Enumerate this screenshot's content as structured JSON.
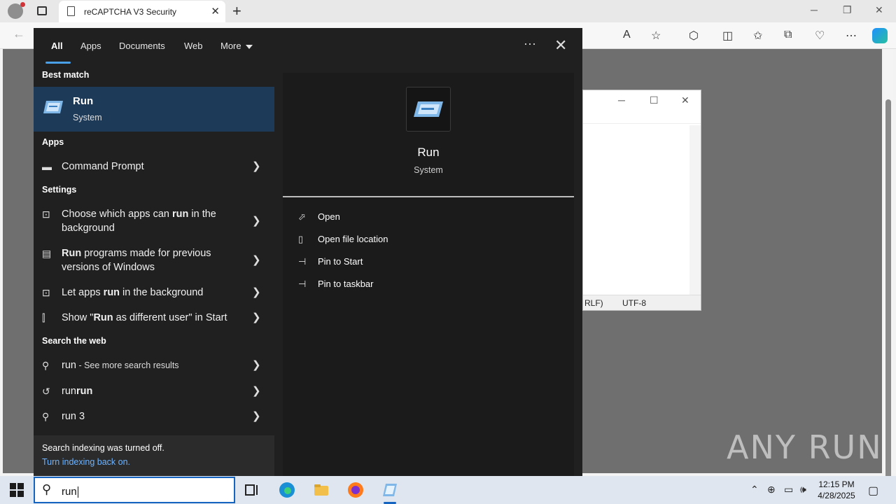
{
  "browser": {
    "tab_title": "reCAPTCHA V3 Security"
  },
  "notepad": {
    "status_encoding_left": "RLF)",
    "status_encoding": "UTF-8"
  },
  "watermark": "ANY RUN",
  "search": {
    "tabs": [
      {
        "label": "All",
        "active": true
      },
      {
        "label": "Apps"
      },
      {
        "label": "Documents"
      },
      {
        "label": "Web"
      },
      {
        "label": "More"
      }
    ],
    "best_match_heading": "Best match",
    "best_match": {
      "name": "Run",
      "sub": "System"
    },
    "apps_heading": "Apps",
    "apps": [
      {
        "label": "Command Prompt"
      }
    ],
    "settings_heading": "Settings",
    "settings": [
      {
        "pre": "Choose which apps can ",
        "bold": "run",
        "post": " in the background"
      },
      {
        "pre": "",
        "bold": "Run",
        "post": " programs made for previous versions of Windows"
      },
      {
        "pre": "Let apps ",
        "bold": "run",
        "post": " in the background"
      },
      {
        "pre": "Show \"",
        "bold": "Run",
        "post": " as different user\" in Start"
      }
    ],
    "web_heading": "Search the web",
    "web": [
      {
        "main": "run",
        "extra": " - See more search results"
      },
      {
        "main": "run",
        "bold": "run"
      },
      {
        "main": "run 3"
      }
    ],
    "footer": {
      "line1": "Search indexing was turned off.",
      "line2": "Turn indexing back on."
    },
    "preview": {
      "name": "Run",
      "sub": "System",
      "actions": [
        "Open",
        "Open file location",
        "Pin to Start",
        "Pin to taskbar"
      ]
    }
  },
  "taskbar": {
    "search_value": "run",
    "time": "12:15 PM",
    "date": "4/28/2025"
  }
}
